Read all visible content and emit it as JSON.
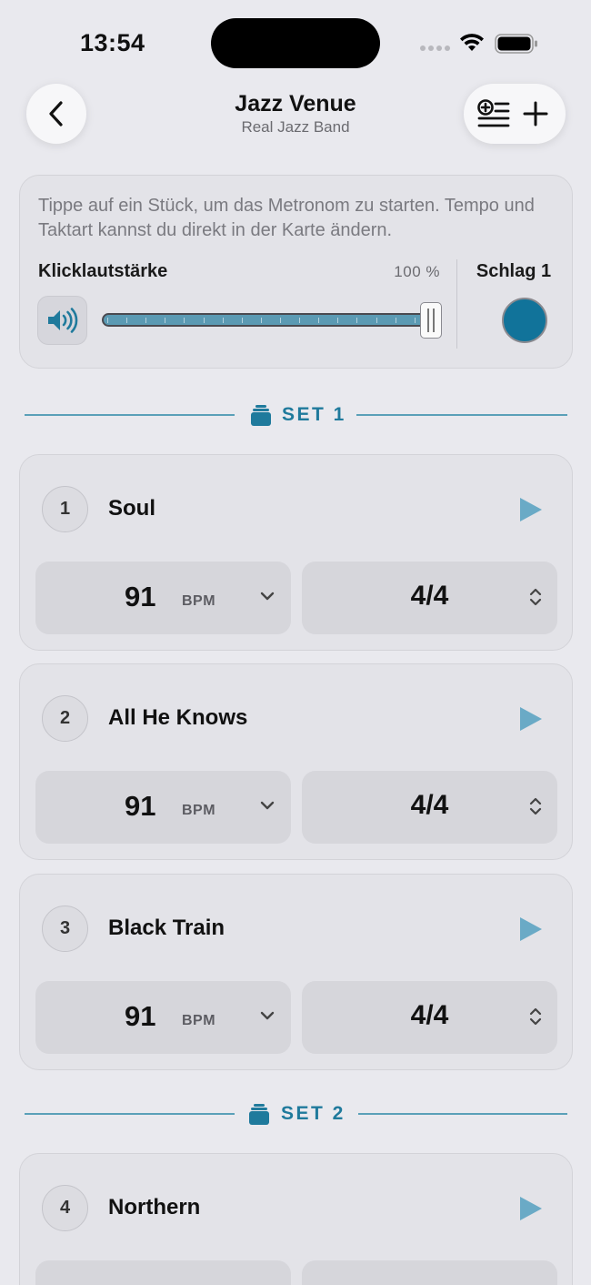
{
  "status_bar": {
    "time": "13:54"
  },
  "nav": {
    "title": "Jazz Venue",
    "subtitle": "Real Jazz Band",
    "back_icon": "chevron-left-icon",
    "list_add_icon": "list-add-icon",
    "add_icon": "plus-icon"
  },
  "info": {
    "description": "Tippe auf ein Stück, um das Metronom zu starten. Tempo und Taktart kannst du direkt in der Karte ändern.",
    "volume_label": "Klicklautstärke",
    "volume_value": "100 %",
    "volume_level": 1.0,
    "beat_label": "Schlag 1",
    "beat_color": "#11739a"
  },
  "sets": [
    {
      "label": "SET 1"
    },
    {
      "label": "SET 2"
    }
  ],
  "songs": [
    {
      "number": "1",
      "title": "Soul",
      "bpm": "91",
      "bpm_unit": "BPM",
      "time_signature": "4/4"
    },
    {
      "number": "2",
      "title": "All He Knows",
      "bpm": "91",
      "bpm_unit": "BPM",
      "time_signature": "4/4"
    },
    {
      "number": "3",
      "title": "Black Train",
      "bpm": "91",
      "bpm_unit": "BPM",
      "time_signature": "4/4"
    },
    {
      "number": "4",
      "title": "Northern",
      "bpm": "",
      "bpm_unit": "",
      "time_signature": ""
    }
  ],
  "colors": {
    "accent": "#1f7a9c",
    "play": "#6aaac6",
    "slider_fill": "#5b9ab3"
  }
}
